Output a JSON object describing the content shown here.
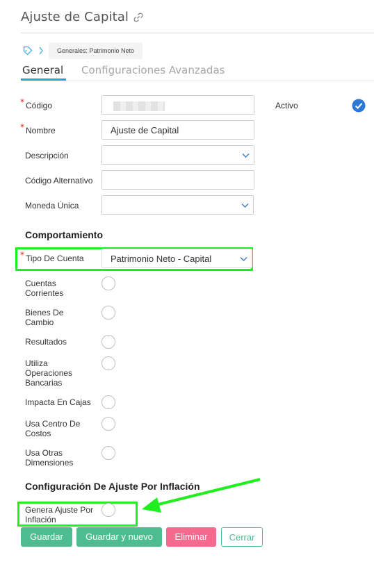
{
  "header": {
    "title": "Ajuste de Capital"
  },
  "breadcrumb": {
    "item": "Generales: Patrimonio Neto"
  },
  "tabs": [
    {
      "label": "General"
    },
    {
      "label": "Configuraciones Avanzadas"
    }
  ],
  "form": {
    "codigo_label": "Código",
    "nombre_label": "Nombre",
    "nombre_value": "Ajuste de Capital",
    "descripcion_label": "Descripción",
    "codigo_alt_label": "Código Alternativo",
    "moneda_label": "Moneda Única",
    "activo_label": "Activo"
  },
  "comportamiento": {
    "title": "Comportamiento",
    "tipo_label": "Tipo De Cuenta",
    "tipo_value": "Patrimonio Neto - Capital",
    "options": [
      "Cuentas Corrientes",
      "Bienes De Cambio",
      "Resultados",
      "Utiliza Operaciones Bancarias",
      "Impacta En Cajas",
      "Usa Centro De Costos",
      "Usa Otras Dimensiones"
    ]
  },
  "inflacion": {
    "title": "Configuración De Ajuste Por Inflación",
    "genera_label": "Genera Ajuste Por Inflación"
  },
  "buttons": {
    "guardar": "Guardar",
    "guardar_nuevo": "Guardar y nuevo",
    "eliminar": "Eliminar",
    "cerrar": "Cerrar"
  },
  "colors": {
    "primary_green": "#4dbd8f",
    "danger_pink": "#f46a8c",
    "highlight": "#20ee20",
    "tab_accent": "#2aa3cf"
  }
}
